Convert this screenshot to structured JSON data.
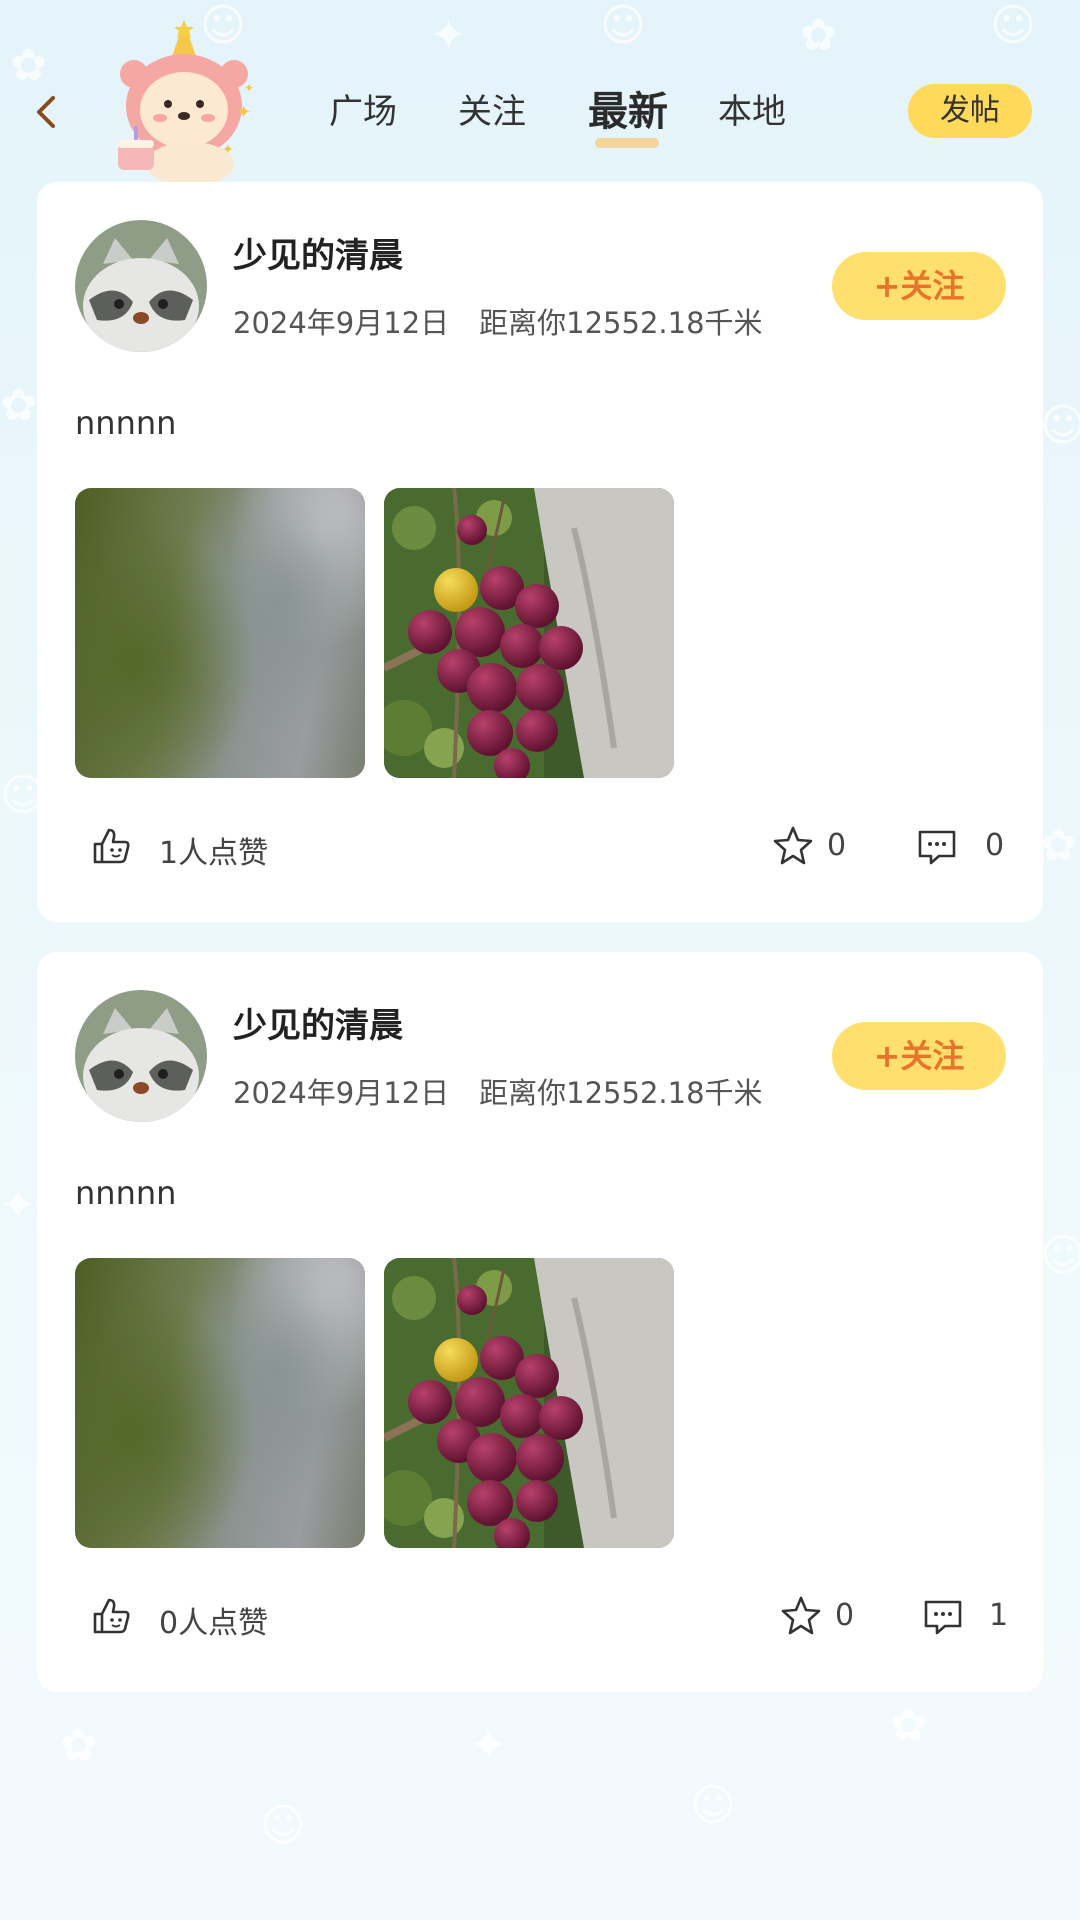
{
  "header": {
    "tabs": [
      {
        "label": "广场"
      },
      {
        "label": "关注"
      },
      {
        "label": "最新"
      },
      {
        "label": "本地"
      }
    ],
    "active_tab": "最新",
    "post_button_label": "发帖"
  },
  "posts": [
    {
      "username": "少见的清晨",
      "date": "2024年9月12日",
      "distance": "距离你12552.18千米",
      "follow_label": "+关注",
      "content": "nnnnn",
      "likes_text": "1人点赞",
      "favorites": "0",
      "comments": "0"
    },
    {
      "username": "少见的清晨",
      "date": "2024年9月12日",
      "distance": "距离你12552.18千米",
      "follow_label": "+关注",
      "content": "nnnnn",
      "likes_text": "0人点赞",
      "favorites": "0",
      "comments": "1"
    }
  ],
  "colors": {
    "accent_yellow": "#ffd95a",
    "follow_text": "#e8732a",
    "tab_underline": "#f3d49a"
  }
}
